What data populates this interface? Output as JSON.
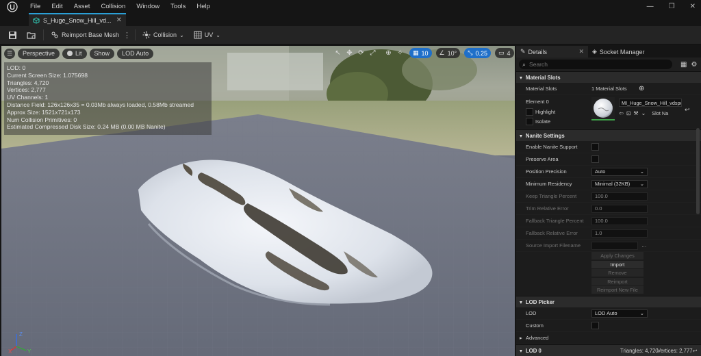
{
  "menu": [
    "File",
    "Edit",
    "Asset",
    "Collision",
    "Window",
    "Tools",
    "Help"
  ],
  "tab": {
    "title": "S_Huge_Snow_Hill_vd..."
  },
  "toolbar": {
    "reimport_label": "Reimport Base Mesh",
    "collision_label": "Collision",
    "uv_label": "UV"
  },
  "viewport": {
    "perspective": "Perspective",
    "lit": "Lit",
    "show": "Show",
    "lod": "LOD Auto",
    "grid_snap": "10",
    "angle_snap": "10°",
    "scale_snap": "0.25",
    "camera_speed": "4"
  },
  "stats": [
    "LOD: 0",
    "Current Screen Size: 1.075698",
    "Triangles: 4,720",
    "Vertices: 2,777",
    "UV Channels: 1",
    "Distance Field: 126x126x35 = 0.03Mb always loaded, 0.58Mb streamed",
    "Approx Size: 1521x721x173",
    "Num Collision Primitives: 0",
    "Estimated Compressed Disk Size: 0.24 MB (0.00 MB Nanite)"
  ],
  "details": {
    "tab_details": "Details",
    "tab_socket": "Socket Manager",
    "search_placeholder": "Search",
    "material_slots_header": "Material Slots",
    "material_slots_label": "Material Slots",
    "material_slots_value": "1 Material Slots",
    "element0": "Element 0",
    "highlight": "Highlight",
    "isolate": "Isolate",
    "material_name": "MI_Huge_Snow_Hill_vdspda",
    "slot_name": "Slot Na",
    "nanite_header": "Nanite Settings",
    "enable_nanite": "Enable Nanite Support",
    "preserve_area": "Preserve Area",
    "position_precision": "Position Precision",
    "position_precision_value": "Auto",
    "min_residency": "Minimum Residency",
    "min_residency_value": "Minimal (32KB)",
    "keep_triangle": "Keep Triangle Percent",
    "keep_triangle_value": "100.0",
    "trim_error": "Trim Relative Error",
    "trim_error_value": "0.0",
    "fallback_triangle": "Fallback Triangle Percent",
    "fallback_triangle_value": "100.0",
    "fallback_error": "Fallback Relative Error",
    "fallback_error_value": "1.0",
    "source_import": "Source Import Filename",
    "apply_changes": "Apply Changes",
    "import": "Import",
    "remove": "Remove",
    "reimport": "Reimport",
    "reimport_new": "Reimport New File",
    "lod_picker_header": "LOD Picker",
    "lod_label": "LOD",
    "lod_value": "LOD Auto",
    "custom": "Custom",
    "advanced": "Advanced",
    "lod0_header": "LOD 0",
    "lod0_triangles": "Triangles: 4,720",
    "lod0_vertices": "Vertices: 2,777"
  }
}
